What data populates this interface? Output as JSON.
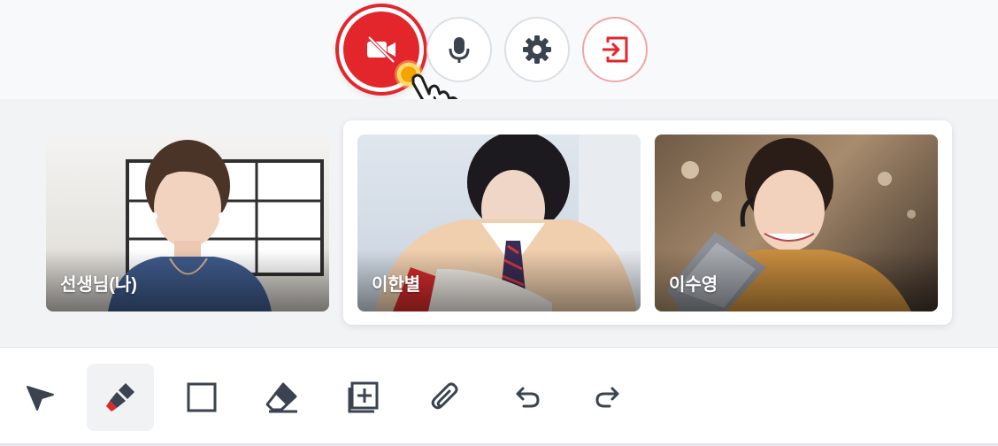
{
  "controls": {
    "video": {
      "icon": "video-off-icon",
      "state": "off"
    },
    "mic": {
      "icon": "microphone-icon"
    },
    "settings": {
      "icon": "gear-icon"
    },
    "leave": {
      "icon": "exit-icon"
    }
  },
  "participants": {
    "teacher": {
      "name": "선생님(나)"
    },
    "students": [
      {
        "name": "이한별"
      },
      {
        "name": "이수영"
      }
    ]
  },
  "toolbar": {
    "tools": [
      {
        "icon": "pointer-icon"
      },
      {
        "icon": "highlighter-icon",
        "active": true
      },
      {
        "icon": "rectangle-icon"
      },
      {
        "icon": "eraser-icon"
      },
      {
        "icon": "add-page-icon"
      },
      {
        "icon": "paperclip-icon"
      },
      {
        "icon": "undo-icon"
      },
      {
        "icon": "redo-icon"
      }
    ]
  },
  "colors": {
    "accent_red": "#e3262b",
    "icon_gray": "#3b4350"
  }
}
